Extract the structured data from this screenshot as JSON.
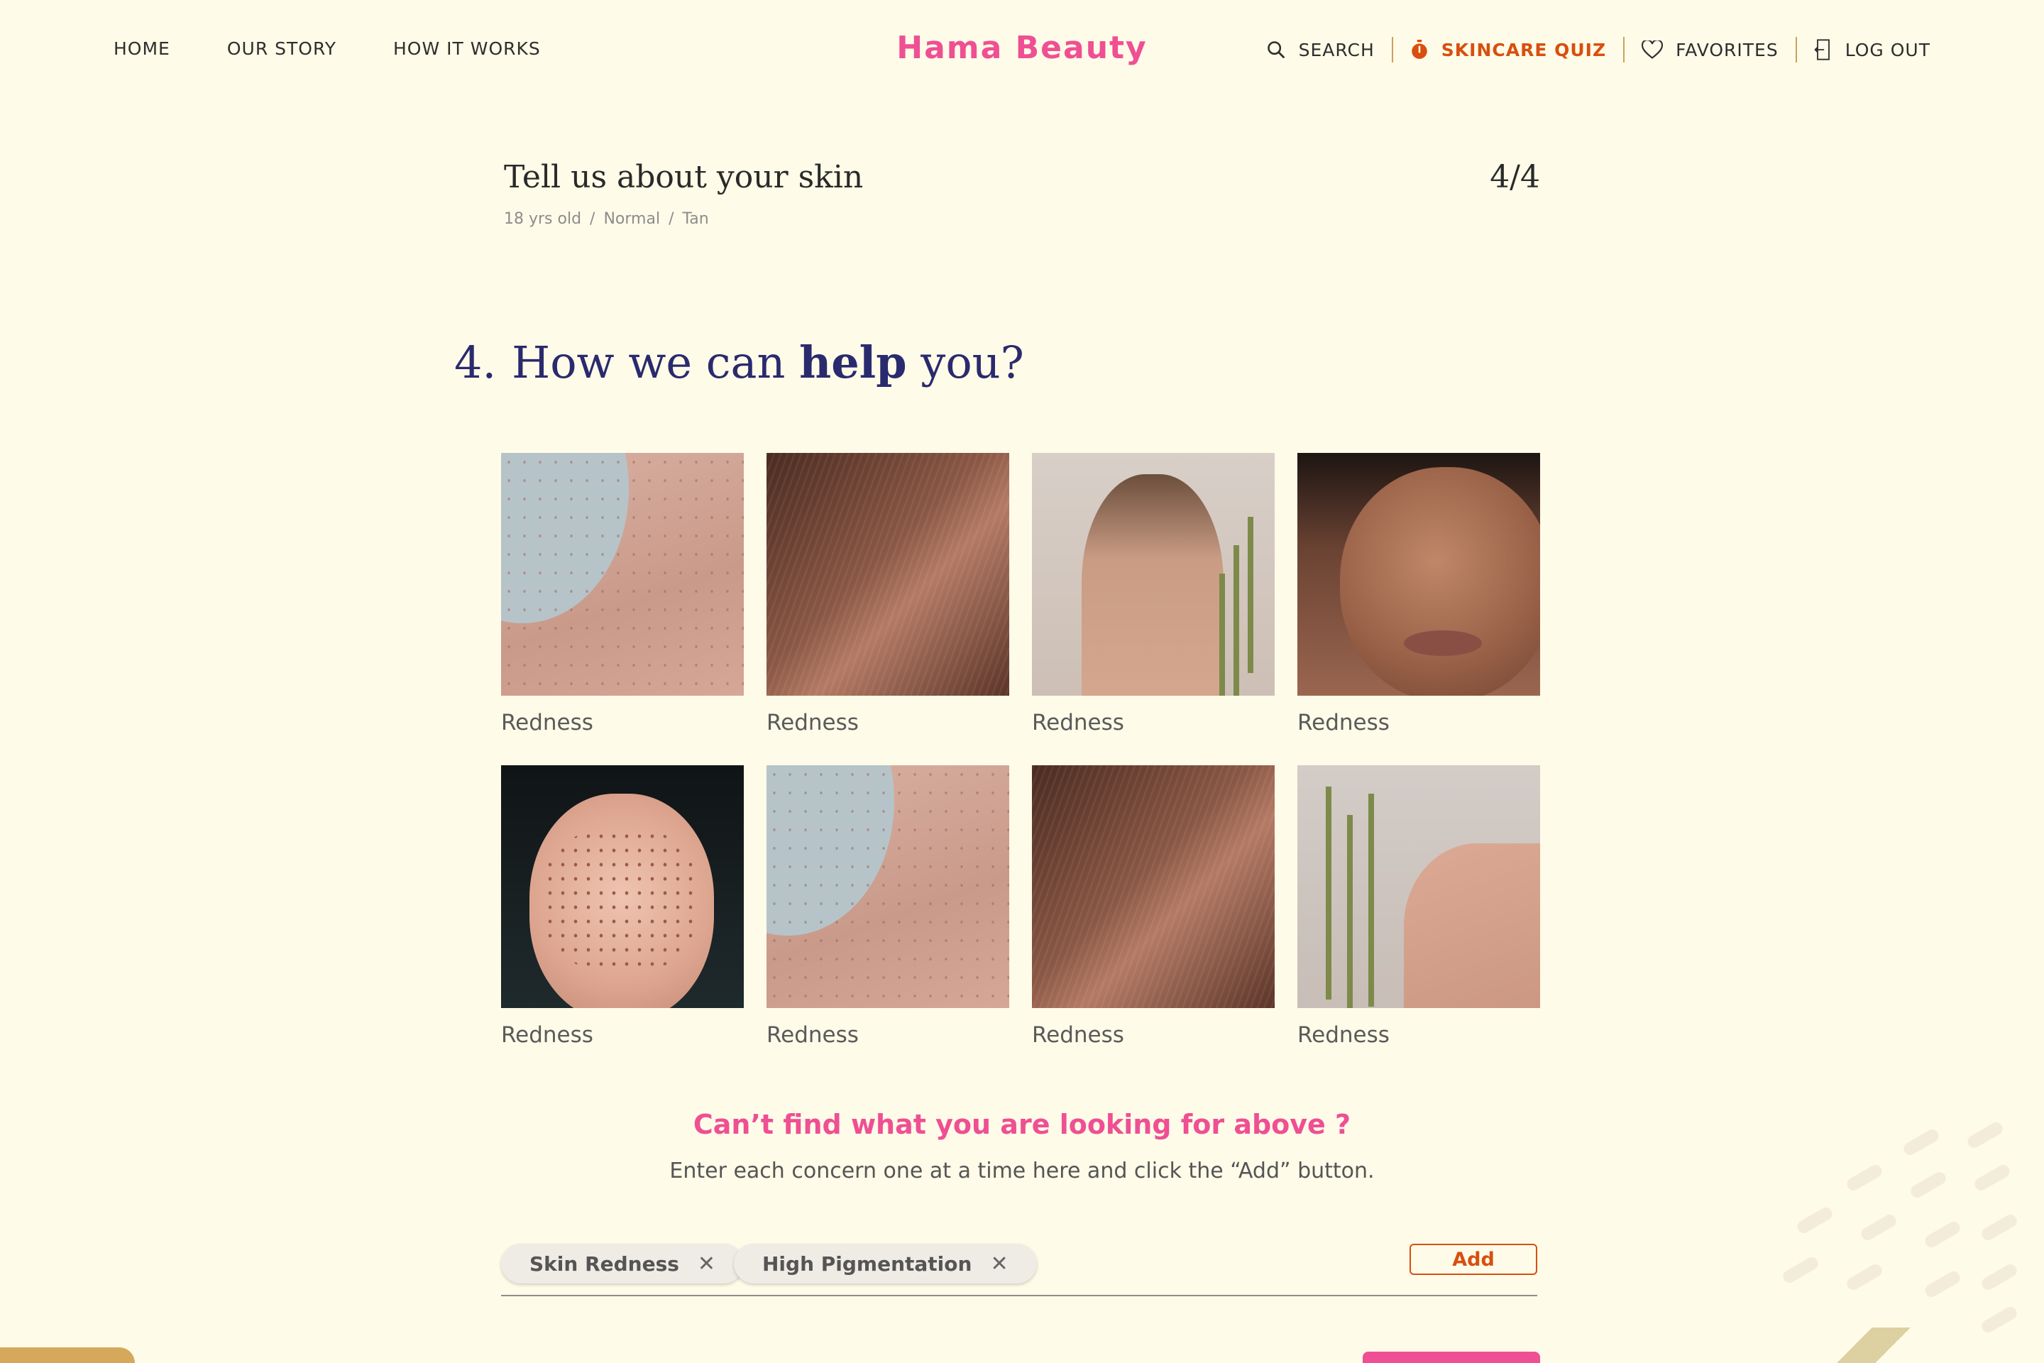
{
  "nav": {
    "left": [
      "HOME",
      "OUR STORY",
      "HOW IT WORKS"
    ],
    "brand": "Hama Beauty",
    "search_label": "SEARCH",
    "quiz_label": "SKINCARE QUIZ",
    "favorites_label": "FAVORITES",
    "logout_label": "LOG OUT"
  },
  "step": {
    "title": "Tell us about your skin",
    "counter": "4/4",
    "summary": [
      "18 yrs old",
      "Normal",
      "Tan"
    ]
  },
  "question": {
    "number": "4.",
    "prefix": "How we can",
    "emphasis": "help",
    "suffix": "you?"
  },
  "concerns": [
    {
      "label": "Redness",
      "image": "shoulder-freckles"
    },
    {
      "label": "Redness",
      "image": "dark-skin-texture"
    },
    {
      "label": "Redness",
      "image": "woman-back-braid"
    },
    {
      "label": "Redness",
      "image": "face-acne"
    },
    {
      "label": "Redness",
      "image": "face-freckles"
    },
    {
      "label": "Redness",
      "image": "shoulder-freckles"
    },
    {
      "label": "Redness",
      "image": "dark-skin-texture"
    },
    {
      "label": "Redness",
      "image": "woman-back-flowers"
    }
  ],
  "custom": {
    "title": "Can’t find what you are looking for above ?",
    "subtitle": "Enter each concern one at a time here and click the “Add” button.",
    "tags": [
      "Skin Redness",
      "High Pigmentation"
    ],
    "add_label": "Add"
  },
  "colors": {
    "background": "#fefbe8",
    "brand_pink": "#ef4f93",
    "accent_orange": "#d84f0f",
    "question_navy": "#2a2a6e"
  }
}
